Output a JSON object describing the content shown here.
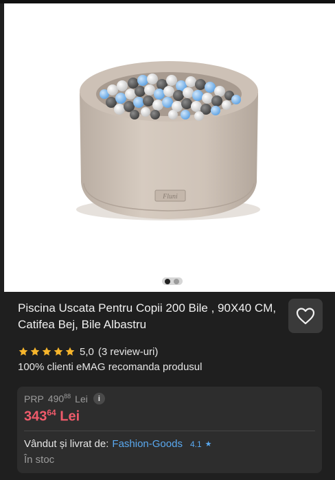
{
  "product": {
    "title": "Piscina Uscata Pentru Copii 200 Bile , 90X40 CM, Catifea Bej, Bile Albastru",
    "image_alt_logo_text": "Fluni",
    "gallery": {
      "total": 2,
      "current": 1
    }
  },
  "rating": {
    "stars": 5,
    "value": "5,0",
    "reviews": "(3 review-uri)"
  },
  "recommend_text": "100% clienti eMAG recomanda produsul",
  "pricing": {
    "prp_label": "PRP",
    "prp_int": "490",
    "prp_dec": "88",
    "prp_currency": "Lei",
    "price_int": "343",
    "price_dec": "64",
    "price_currency": "Lei",
    "info_icon": "i"
  },
  "seller": {
    "label": "Vândut și livrat de:",
    "name": "Fashion-Goods",
    "rating": "4.1",
    "rating_icon": "★"
  },
  "stock": "În stoc",
  "colors": {
    "background": "#1f1f1f",
    "card": "#2d2d2d",
    "price": "#f05b6b",
    "link": "#5aa9f0",
    "star": "#f6b52c"
  }
}
